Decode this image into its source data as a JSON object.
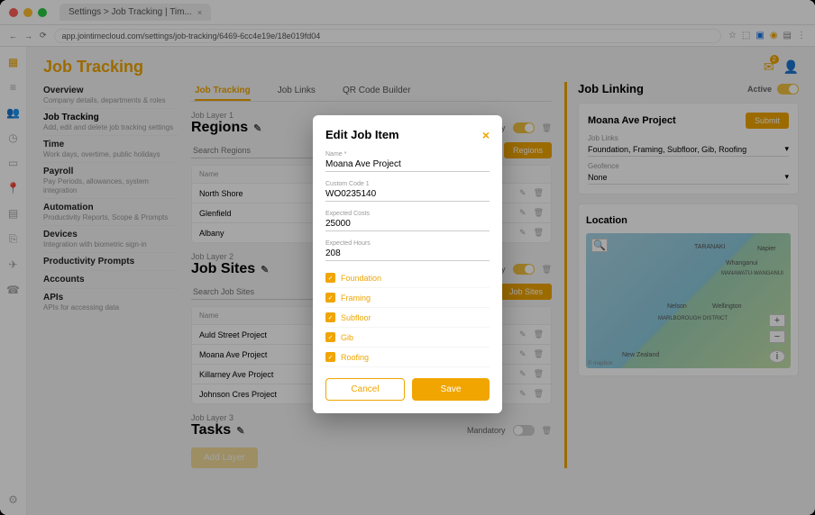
{
  "browser": {
    "tab_title": "Settings > Job Tracking | Tim...",
    "url": "app.jointimecloud.com/settings/job-tracking/6469-6cc4e19e/18e019fd04",
    "nav_back": "←",
    "nav_fwd": "→",
    "nav_reload": "⟳"
  },
  "header": {
    "title": "Job Tracking",
    "mail_icon": "✉",
    "user_icon": "👤",
    "badge": "2"
  },
  "sidenav": [
    {
      "title": "Overview",
      "sub": "Company details, departments & roles"
    },
    {
      "title": "Job Tracking",
      "sub": "Add, edit and delete job tracking settings",
      "active": true
    },
    {
      "title": "Time",
      "sub": "Work days, overtime, public holidays"
    },
    {
      "title": "Payroll",
      "sub": "Pay Periods, allowances, system integration"
    },
    {
      "title": "Automation",
      "sub": "Productivity Reports, Scope & Prompts"
    },
    {
      "title": "Devices",
      "sub": "Integration with biometric sign-in"
    },
    {
      "title": "Productivity Prompts",
      "sub": ""
    },
    {
      "title": "Accounts",
      "sub": ""
    },
    {
      "title": "APIs",
      "sub": "APIs for accessing data"
    }
  ],
  "tabs": {
    "t1": "Job Tracking",
    "t2": "Job Links",
    "t3": "QR Code Builder"
  },
  "layers": {
    "regions": {
      "layer_lbl": "Job Layer 1",
      "title": "Regions",
      "mandatory": "Mandatory",
      "search_ph": "Search Regions",
      "plus": "+",
      "manage": "Regions",
      "th": "Name",
      "rows": [
        "North Shore",
        "Glenfield",
        "Albany"
      ]
    },
    "sites": {
      "layer_lbl": "Job Layer 2",
      "title": "Job Sites",
      "mandatory": "Mandatory",
      "search_ph": "Search Job Sites",
      "plus": "+",
      "manage": "Job Sites",
      "th": "Name",
      "rows": [
        "Auld Street Project",
        "Moana Ave Project",
        "Killarney Ave Project",
        "Johnson Cres Project"
      ]
    },
    "tasks": {
      "layer_lbl": "Job Layer 3",
      "title": "Tasks",
      "mandatory": "Mandatory"
    },
    "add_layer": "Add Layer"
  },
  "linking": {
    "title": "Job Linking",
    "active": "Active",
    "project": "Moana Ave Project",
    "submit": "Submit",
    "joblinks_lbl": "Job Links",
    "joblinks_val": "Foundation, Framing, Subfloor, Gib, Roofing",
    "geofence_lbl": "Geofence",
    "geofence_val": "None",
    "location": "Location",
    "map_places": [
      "TARANAKI",
      "Napier",
      "Whanganui",
      "MANAWATU-WANGANUI",
      "Nelson",
      "Wellington",
      "MARLBOROUGH DISTRICT",
      "New Zealand"
    ],
    "map_attrib": "© mapbox",
    "zoom_in": "+",
    "zoom_out": "−",
    "info": "i"
  },
  "modal": {
    "title": "Edit Job Item",
    "close": "×",
    "fields": [
      {
        "label": "Name *",
        "value": "Moana Ave Project"
      },
      {
        "label": "Custom Code 1",
        "value": "WO0235140"
      },
      {
        "label": "Expected Costs",
        "value": "25000"
      },
      {
        "label": "Expected Hours",
        "value": "208"
      }
    ],
    "checks": [
      "Foundation",
      "Framing",
      "Subfloor",
      "Gib",
      "Roofing"
    ],
    "cancel": "Cancel",
    "save": "Save"
  },
  "iconrail": [
    "▦",
    "≡",
    "👥",
    "◷",
    "▭",
    "📍",
    "▤",
    "⎘",
    "✈",
    "☎"
  ],
  "iconrail_bottom": "⚙"
}
